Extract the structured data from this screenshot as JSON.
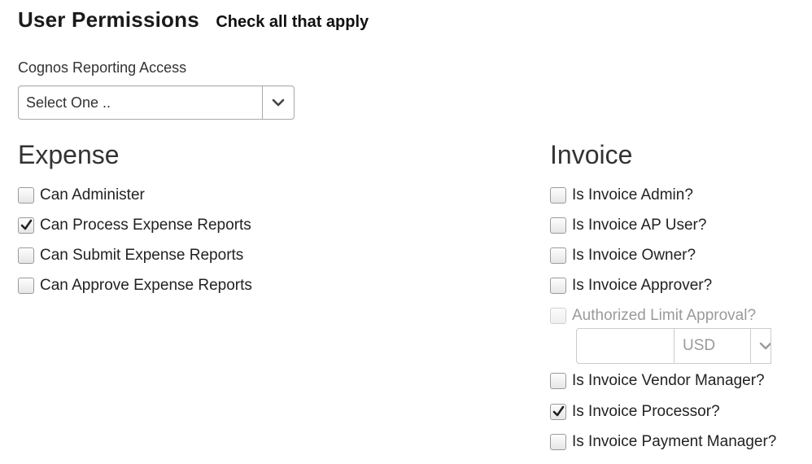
{
  "header": {
    "title": "User Permissions",
    "subtitle": "Check all that apply"
  },
  "cognos": {
    "label": "Cognos Reporting Access",
    "selected": "Select One .."
  },
  "expense": {
    "title": "Expense",
    "items": [
      {
        "label": "Can Administer",
        "checked": false
      },
      {
        "label": "Can Process Expense Reports",
        "checked": true
      },
      {
        "label": "Can Submit Expense Reports",
        "checked": false
      },
      {
        "label": "Can Approve Expense Reports",
        "checked": false
      }
    ]
  },
  "invoice": {
    "title": "Invoice",
    "items": [
      {
        "label": "Is Invoice Admin?",
        "checked": false
      },
      {
        "label": "Is Invoice AP User?",
        "checked": false
      },
      {
        "label": "Is Invoice Owner?",
        "checked": false
      },
      {
        "label": "Is Invoice Approver?",
        "checked": false
      },
      {
        "label": "Authorized Limit Approval?",
        "checked": false,
        "disabled": true
      },
      {
        "label": "Is Invoice Vendor Manager?",
        "checked": false
      },
      {
        "label": "Is Invoice Processor?",
        "checked": true
      },
      {
        "label": "Is Invoice Payment Manager?",
        "checked": false
      }
    ],
    "limit": {
      "amount": "",
      "currency": "USD"
    }
  },
  "icons": {
    "checkmark": "checkmark-icon",
    "dropdown": "chevron-down-icon"
  },
  "colors": {
    "text": "#222222",
    "disabled_text": "#9a9a9a",
    "border": "#aaaaaa"
  }
}
